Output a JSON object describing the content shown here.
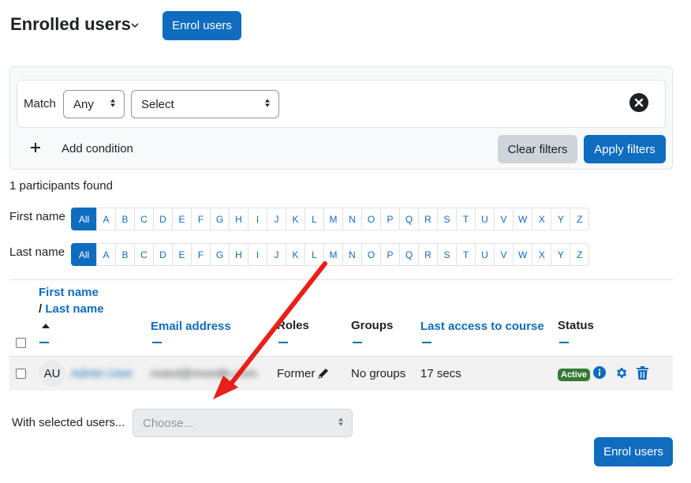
{
  "header": {
    "title": "Enrolled users",
    "enrol_label": "Enrol users"
  },
  "filters": {
    "match_label": "Match",
    "match_value": "Any",
    "type_value": "Select",
    "add_condition_label": "Add condition",
    "clear_label": "Clear filters",
    "apply_label": "Apply filters"
  },
  "summary": {
    "count_text": "1 participants found"
  },
  "initials": {
    "first_label": "First name",
    "last_label": "Last name",
    "all_label": "All",
    "letters": [
      "A",
      "B",
      "C",
      "D",
      "E",
      "F",
      "G",
      "H",
      "I",
      "J",
      "K",
      "L",
      "M",
      "N",
      "O",
      "P",
      "Q",
      "R",
      "S",
      "T",
      "U",
      "V",
      "W",
      "X",
      "Y",
      "Z"
    ]
  },
  "table": {
    "col_firstname": "First name",
    "col_slash": "/",
    "col_lastname": "Last name",
    "col_email": "Email address",
    "col_roles": "Roles",
    "col_groups": "Groups",
    "col_lastaccess": "Last access to course",
    "col_status": "Status",
    "rows": [
      {
        "initials": "AU",
        "name": "Admin User",
        "email": "noted@moodle.com",
        "role": "Former",
        "groups": "No groups",
        "last_access": "17 secs",
        "status": "Active"
      }
    ]
  },
  "bulk": {
    "label": "With selected users...",
    "placeholder": "Choose...",
    "enrol_label": "Enrol users"
  },
  "colors": {
    "primary": "#0f6cbf",
    "active_badge": "#357a32",
    "annotation_arrow": "#e8201a"
  },
  "icons": [
    "chevron-down-icon",
    "close-icon",
    "plus-icon",
    "sort-up-icon",
    "pencil-icon",
    "info-icon",
    "gear-icon",
    "trash-icon"
  ]
}
